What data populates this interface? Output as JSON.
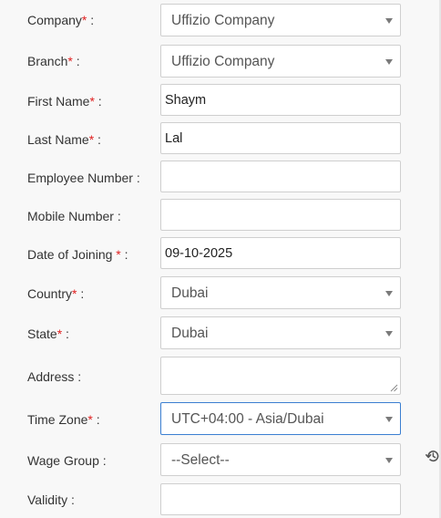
{
  "form": {
    "company": {
      "label": "Company",
      "required": "*",
      "colon": " :",
      "value": "Uffizio Company"
    },
    "branch": {
      "label": "Branch",
      "required": "*",
      "colon": " :",
      "value": "Uffizio Company"
    },
    "first_name": {
      "label": "First Name",
      "required": "*",
      "colon": " :",
      "value": "Shaym"
    },
    "last_name": {
      "label": "Last Name",
      "required": "*",
      "colon": " :",
      "value": "Lal"
    },
    "employee_number": {
      "label": "Employee Number :",
      "value": ""
    },
    "mobile_number": {
      "label": "Mobile Number :",
      "value": ""
    },
    "date_of_joining": {
      "label": "Date of Joining ",
      "required": "*",
      "colon": " :",
      "value": "09-10-2025"
    },
    "country": {
      "label": "Country",
      "required": "*",
      "colon": " :",
      "value": "Dubai"
    },
    "state": {
      "label": "State",
      "required": "*",
      "colon": " :",
      "value": "Dubai"
    },
    "address": {
      "label": "Address :",
      "value": ""
    },
    "time_zone": {
      "label": "Time Zone",
      "required": "*",
      "colon": " :",
      "value": "UTC+04:00 - Asia/Dubai"
    },
    "wage_group": {
      "label": "Wage Group :",
      "value": "--Select--"
    },
    "validity": {
      "label": "Validity :",
      "value": ""
    }
  },
  "icons": {
    "wage_group_history": "history-icon"
  },
  "colors": {
    "required": "#e02020",
    "focus_border": "#3b7fd1",
    "background": "#f8f8f8"
  }
}
